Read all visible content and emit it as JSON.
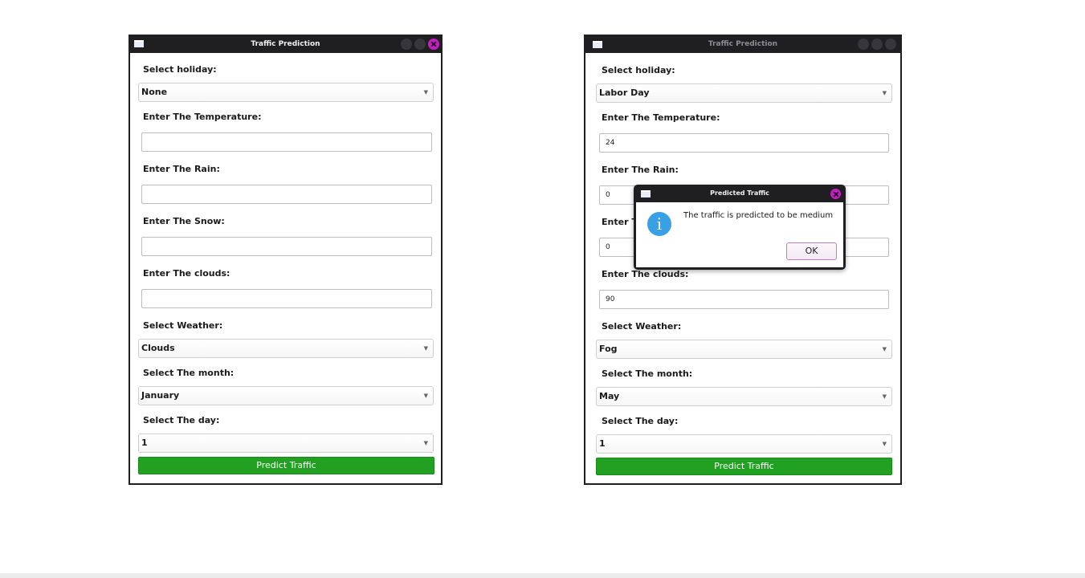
{
  "window_left": {
    "title": "Traffic Prediction",
    "holiday_label": "Select holiday:",
    "holiday_value": "None",
    "temperature_label": "Enter The Temperature:",
    "temperature_value": "",
    "rain_label": "Enter The Rain:",
    "rain_value": "",
    "snow_label": "Enter The Snow:",
    "snow_value": "",
    "clouds_label": "Enter The clouds:",
    "clouds_value": "",
    "weather_label": "Select Weather:",
    "weather_value": "Clouds",
    "month_label": "Select The month:",
    "month_value": "January",
    "day_label": "Select The day:",
    "day_value": "1",
    "predict_label": "Predict Traffic"
  },
  "window_right": {
    "title": "Traffic Prediction",
    "holiday_label": "Select holiday:",
    "holiday_value": "Labor Day",
    "temperature_label": "Enter The Temperature:",
    "temperature_value": "24",
    "rain_label": "Enter The Rain:",
    "rain_value": "0",
    "snow_label_visible": "Enter T",
    "snow_value": "0",
    "clouds_label": "Enter The clouds:",
    "clouds_value": "90",
    "weather_label": "Select Weather:",
    "weather_value": "Fog",
    "month_label": "Select The month:",
    "month_value": "May",
    "day_label": "Select The day:",
    "day_value": "1",
    "predict_label": "Predict Traffic"
  },
  "dialog": {
    "title": "Predicted Traffic",
    "message": "The traffic is predicted to be medium",
    "ok_label": "OK",
    "icon": "info-icon"
  },
  "colors": {
    "titlebar": "#1f1f22",
    "close_button": "#c71ec4",
    "predict_button": "#21a021",
    "info_icon": "#3aa0e6"
  }
}
